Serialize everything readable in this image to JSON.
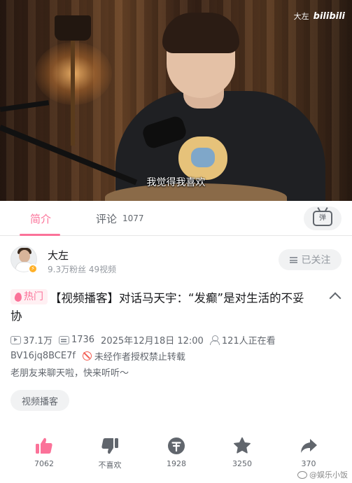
{
  "video": {
    "watermark_author": "大左",
    "watermark_brand": "bilibili",
    "subtitle": "我觉得我喜欢"
  },
  "tabs": {
    "intro": "简介",
    "comments": "评论",
    "comment_count": "1077",
    "danmaku_icon_text": "弹"
  },
  "author": {
    "name": "大左",
    "stats": "9.3万粉丝  49视频",
    "follow_label": "已关注",
    "verified_badge": "⚡"
  },
  "video_info": {
    "hot_label": "热门",
    "title": "【视频播客】对话马天宇：“发癫”是对生活的不妥协",
    "views": "37.1万",
    "danmaku": "1736",
    "date": "2025年12月18日 12:00",
    "watching": "121人正在看",
    "bvid": "BV16jq8BCE7f",
    "copyright": "未经作者授权禁止转载",
    "description": "老朋友来聊天啦，快来听听～",
    "tag": "视频播客"
  },
  "actions": {
    "like": "7062",
    "dislike": "不喜欢",
    "coin": "1928",
    "favorite": "3250",
    "share": "370"
  },
  "watermark": {
    "text": "@娱乐小饭"
  },
  "colors": {
    "accent": "#fb7299",
    "secondary_text": "#61666d",
    "icon_dark": "#61666d"
  }
}
